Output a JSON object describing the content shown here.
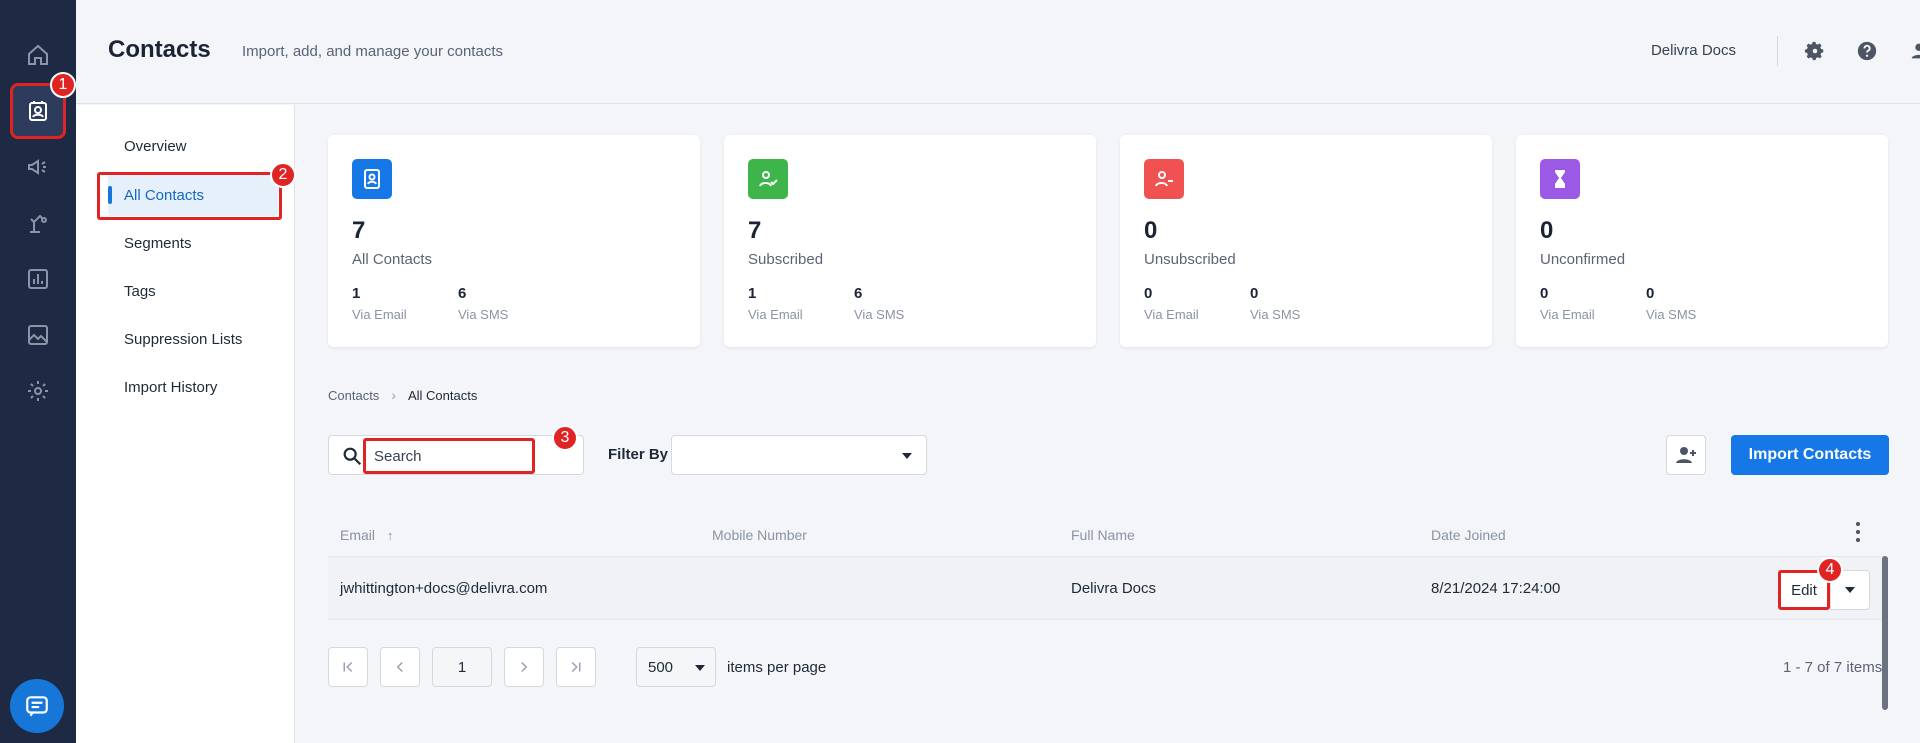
{
  "header": {
    "title": "Contacts",
    "subtitle": "Import, add, and manage your contacts",
    "account_name": "Delivra Docs"
  },
  "rail": {
    "items": [
      "home-icon",
      "contacts-icon",
      "megaphone-icon",
      "automation-icon",
      "reports-icon",
      "image-icon",
      "gear-icon"
    ],
    "active": "contacts-icon"
  },
  "subnav": {
    "items": [
      "Overview",
      "All Contacts",
      "Segments",
      "Tags",
      "Suppression Lists",
      "Import History"
    ],
    "active": "All Contacts"
  },
  "cards": [
    {
      "value": "7",
      "label": "All Contacts",
      "email": "1",
      "sms": "6",
      "color": "#1677e6"
    },
    {
      "value": "7",
      "label": "Subscribed",
      "email": "1",
      "sms": "6",
      "color": "#3db54a"
    },
    {
      "value": "0",
      "label": "Unsubscribed",
      "email": "0",
      "sms": "0",
      "color": "#f05252"
    },
    {
      "value": "0",
      "label": "Unconfirmed",
      "email": "0",
      "sms": "0",
      "color": "#9b59e6"
    }
  ],
  "labels": {
    "via_email": "Via Email",
    "via_sms": "Via SMS"
  },
  "breadcrumb": {
    "root": "Contacts",
    "current": "All Contacts"
  },
  "toolbar": {
    "search_placeholder": "Search",
    "filter_label": "Filter By",
    "import_label": "Import Contacts"
  },
  "table": {
    "columns": [
      "Email",
      "Mobile Number",
      "Full Name",
      "Date Joined"
    ],
    "rows": [
      {
        "email": "jwhittington+docs@delivra.com",
        "mobile": "",
        "name": "Delivra Docs",
        "date": "8/21/2024 17:24:00"
      }
    ],
    "edit_label": "Edit"
  },
  "pager": {
    "page": "1",
    "per_page": "500",
    "per_page_label": "items per page",
    "range": "1 - 7 of 7 items"
  },
  "annotations": [
    "1",
    "2",
    "3",
    "4"
  ]
}
